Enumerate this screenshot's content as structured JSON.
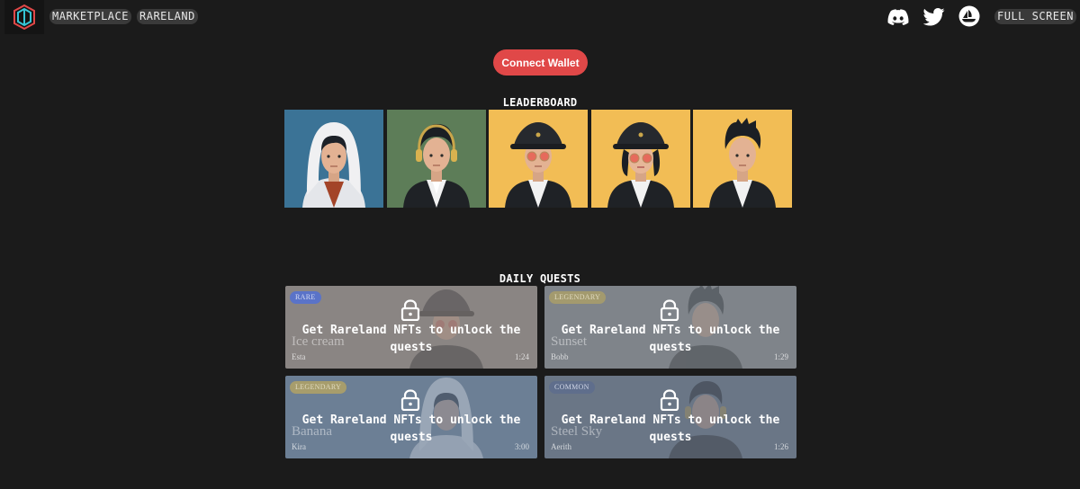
{
  "nav": {
    "marketplace": "MARKETPLACE",
    "rareland": "RARELAND",
    "fullscreen": "FULL SCREEN",
    "icons": [
      "discord-icon",
      "twitter-icon",
      "opensea-icon"
    ]
  },
  "wallet": {
    "connect_label": "Connect Wallet",
    "color": "#e04848"
  },
  "leaderboard": {
    "title": "LEADERBOARD",
    "avatars": [
      {
        "bg": "#3b7396",
        "style": "hoodie"
      },
      {
        "bg": "#5d7d58",
        "style": "headphones"
      },
      {
        "bg": "#f2bd55",
        "style": "bucket-hat-glasses"
      },
      {
        "bg": "#f2bd55",
        "style": "bucket-hat-glasses-bob"
      },
      {
        "bg": "#f2bd55",
        "style": "spiky-hair"
      }
    ]
  },
  "quests": {
    "title": "DAILY QUESTS",
    "lock_message": "Get Rareland NFTs to unlock the quests",
    "items": [
      {
        "badge": "RARE",
        "badge_color": "#5a73c8",
        "name": "Ice cream",
        "owner": "Esta",
        "time": "1:24",
        "bg": "#8a8583"
      },
      {
        "badge": "LEGENDARY",
        "badge_color": "#a39a6e",
        "name": "Sunset",
        "owner": "Bobb",
        "time": "1:29",
        "bg": "#7f848a"
      },
      {
        "badge": "LEGENDARY",
        "badge_color": "#a79d6c",
        "name": "Banana",
        "owner": "Kira",
        "time": "3:00",
        "bg": "#6c7f95"
      },
      {
        "badge": "COMMON",
        "badge_color": "#5f6e8c",
        "name": "Steel Sky",
        "owner": "Aerith",
        "time": "1:26",
        "bg": "#6a7686"
      }
    ]
  }
}
